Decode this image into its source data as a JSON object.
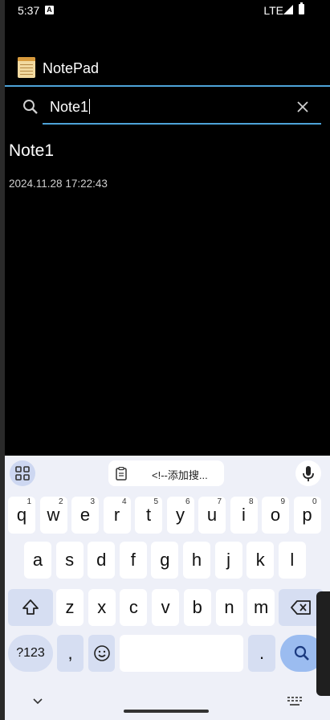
{
  "status": {
    "time": "5:37",
    "network": "LTE"
  },
  "app": {
    "title": "NotePad"
  },
  "search": {
    "value": "Note1"
  },
  "notes": [
    {
      "title": "Note1",
      "timestamp": "2024.11.28 17:22:43"
    }
  ],
  "keyboard": {
    "clipboard_text": "<!--添加搜...",
    "row1": [
      {
        "k": "q",
        "s": "1"
      },
      {
        "k": "w",
        "s": "2"
      },
      {
        "k": "e",
        "s": "3"
      },
      {
        "k": "r",
        "s": "4"
      },
      {
        "k": "t",
        "s": "5"
      },
      {
        "k": "y",
        "s": "6"
      },
      {
        "k": "u",
        "s": "7"
      },
      {
        "k": "i",
        "s": "8"
      },
      {
        "k": "o",
        "s": "9"
      },
      {
        "k": "p",
        "s": "0"
      }
    ],
    "row2": [
      "a",
      "s",
      "d",
      "f",
      "g",
      "h",
      "j",
      "k",
      "l"
    ],
    "row3": [
      "z",
      "x",
      "c",
      "v",
      "b",
      "n",
      "m"
    ],
    "numbers_label": "?123",
    "comma": ",",
    "period": "."
  }
}
